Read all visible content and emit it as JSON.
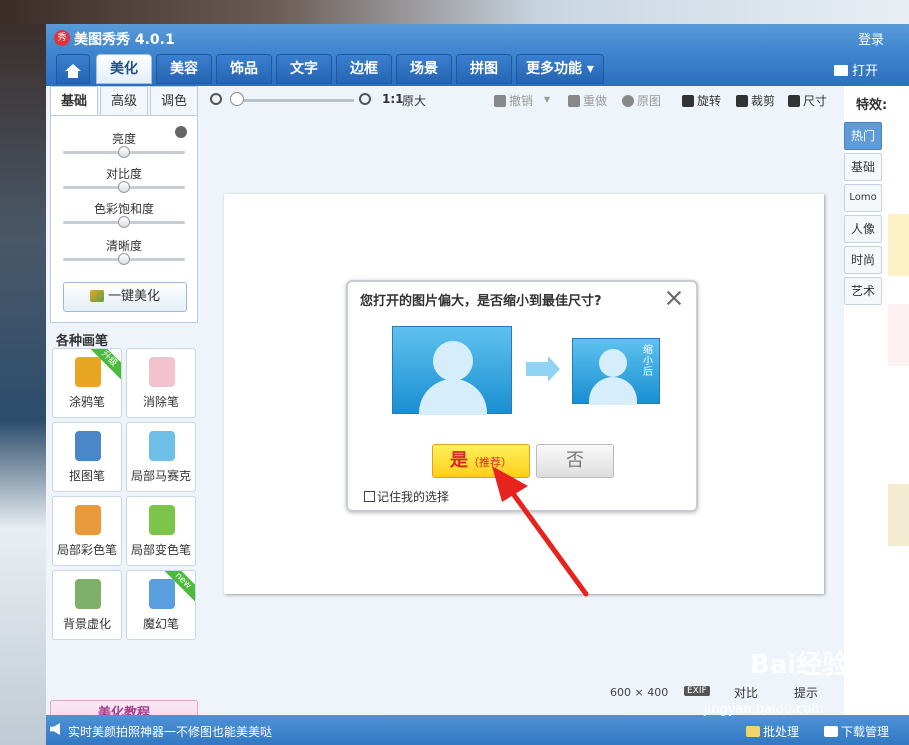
{
  "window": {
    "title": "美图秀秀 4.0.1",
    "logo_text": "秀",
    "login": "登录",
    "open": "打开"
  },
  "tabs": [
    {
      "label": "美化",
      "active": true
    },
    {
      "label": "美容"
    },
    {
      "label": "饰品"
    },
    {
      "label": "文字"
    },
    {
      "label": "边框"
    },
    {
      "label": "场景"
    },
    {
      "label": "拼图"
    },
    {
      "label": "更多功能 ▾"
    }
  ],
  "left_panel": {
    "subtabs": [
      "基础",
      "高级",
      "调色"
    ],
    "sliders": [
      {
        "label": "亮度",
        "value": 0.5
      },
      {
        "label": "对比度",
        "value": 0.5
      },
      {
        "label": "色彩饱和度",
        "value": 0.5
      },
      {
        "label": "清晰度",
        "value": 0.5
      }
    ],
    "one_key": "一键美化",
    "pens_title": "各种画笔",
    "pens": [
      {
        "label": "涂鸦笔",
        "badge": "升级",
        "color": "#e8a522"
      },
      {
        "label": "消除笔",
        "badge": "",
        "color": "#f2c3cf"
      },
      {
        "label": "抠图笔",
        "badge": "",
        "color": "#4a86c8"
      },
      {
        "label": "局部马赛克",
        "badge": "",
        "color": "#6fc0e8"
      },
      {
        "label": "局部彩色笔",
        "badge": "",
        "color": "#e89a3c"
      },
      {
        "label": "局部变色笔",
        "badge": "",
        "color": "#7cc44a"
      },
      {
        "label": "背景虚化",
        "badge": "",
        "color": "#7fb069"
      },
      {
        "label": "魔幻笔",
        "badge": "new",
        "color": "#5a9ee0"
      }
    ],
    "tutorial": "美化教程"
  },
  "toolbar": {
    "zoom_ratio": "1:1",
    "original_size": "原大",
    "undo": "撤销",
    "redo": "重做",
    "original": "原图",
    "rotate": "旋转",
    "crop": "裁剪",
    "size": "尺寸"
  },
  "canvas": {
    "dimensions": "600 × 400",
    "exif": "EXIF",
    "compare": "对比",
    "info": "提示"
  },
  "dialog": {
    "title": "您打开的图片偏大，是否缩小到最佳尺寸?",
    "small_tag": "缩小后",
    "yes_main": "是",
    "yes_sub": "（推荐）",
    "no": "否",
    "remember": "记住我的选择"
  },
  "right_panel": {
    "title": "特效:",
    "tabs": [
      "热门",
      "基础",
      "Lomo",
      "人像",
      "时尚",
      "艺术"
    ]
  },
  "statusbar": {
    "message": "实时美颜拍照神器一不修图也能美美哒",
    "batch": "批处理",
    "download": "下载管理"
  },
  "watermark": {
    "logo": "Bai经验",
    "url": "jingyan.baidu.com"
  }
}
